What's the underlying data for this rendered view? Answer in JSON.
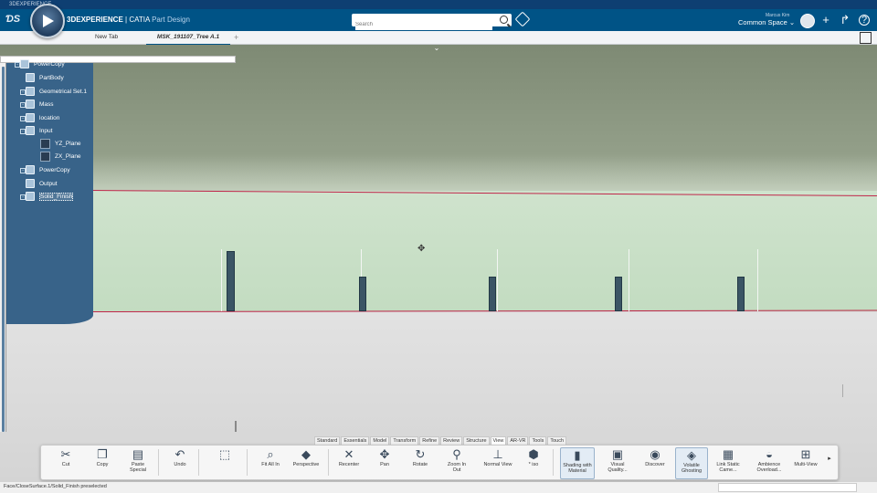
{
  "window": {
    "title": "3DEXPERIENCE"
  },
  "header": {
    "brand": "3DEXPERIENCE",
    "separator": " | ",
    "product": "CATIA",
    "app": "Part Design",
    "search_placeholder": "Search",
    "user_name": "Marcus Kim",
    "space": "Common Space"
  },
  "tabs": {
    "new_tab": "New Tab",
    "active": "MSK_191107_Tree A.1",
    "plus": "+"
  },
  "tree": {
    "items": [
      {
        "label": "PowerCopy"
      },
      {
        "label": "PartBody"
      },
      {
        "label": "Geometrical Set.1"
      },
      {
        "label": "Mass"
      },
      {
        "label": "location"
      },
      {
        "label": "Input"
      },
      {
        "label": "YZ_Plane"
      },
      {
        "label": "ZX_Plane"
      },
      {
        "label": "PowerCopy"
      },
      {
        "label": "Output"
      },
      {
        "label": "Solid_Finish"
      }
    ]
  },
  "command_tabs": [
    "Standard",
    "Essentials",
    "Model",
    "Transform",
    "Refine",
    "Review",
    "Structure",
    "View",
    "AR-VR",
    "Tools",
    "Touch"
  ],
  "active_command_tab": "View",
  "commands": {
    "cut": "Cut",
    "copy": "Copy",
    "paste_special": "Paste Special",
    "undo": "Undo",
    "fit_all_in": "Fit All In",
    "perspective": "Perspective",
    "recenter": "Recenter",
    "pan": "Pan",
    "rotate": "Rotate",
    "zoom_in_out": "Zoom In Out",
    "normal_view": "Normal View",
    "iso": "* iso",
    "shading_with_material": "Shading with Material",
    "visual_quality": "Visual Quality...",
    "discover": "Discover",
    "volatile_ghosting": "Volatile Ghosting",
    "link_static_camera": "Link Static Came...",
    "ambience_overload": "Ambience Overload...",
    "multi_view": "Multi-View"
  },
  "status": {
    "text": "Face/CloseSurface.1/Solid_Finish preselected"
  },
  "colors": {
    "header": "#005386",
    "viewport_wall": "#c9dfc7",
    "edge_line": "#c0264a",
    "tree_panel": "#386389"
  }
}
